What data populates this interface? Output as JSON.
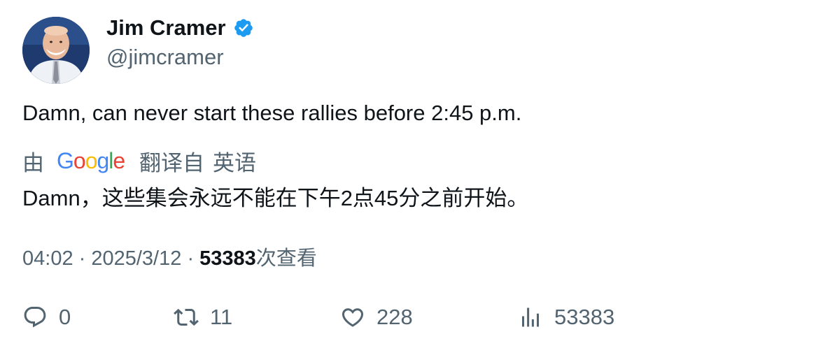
{
  "author": {
    "display_name": "Jim Cramer",
    "handle": "@jimcramer",
    "verified": true,
    "verified_color": "#1d9bf0"
  },
  "tweet": {
    "text": "Damn, can never start these rallies before 2:45 p.m."
  },
  "translation": {
    "by_label": "由",
    "provider_logo": "Google",
    "translated_from_label": "翻译自",
    "source_language": "英语",
    "text": "Damn，这些集会永远不能在下午2点45分之前开始。"
  },
  "meta": {
    "time": "04:02",
    "separator": "·",
    "date": "2025/3/12",
    "views_count": "53383",
    "views_label": "次查看"
  },
  "actions": {
    "reply": {
      "icon": "reply-icon",
      "count": "0"
    },
    "retweet": {
      "icon": "retweet-icon",
      "count": "11"
    },
    "like": {
      "icon": "heart-icon",
      "count": "228"
    },
    "views": {
      "icon": "analytics-icon",
      "count": "53383"
    }
  },
  "colors": {
    "text_primary": "#0f1419",
    "text_secondary": "#536471",
    "google_blue": "#4285F4",
    "google_red": "#EA4335",
    "google_yellow": "#FBBC05",
    "google_green": "#34A853"
  }
}
